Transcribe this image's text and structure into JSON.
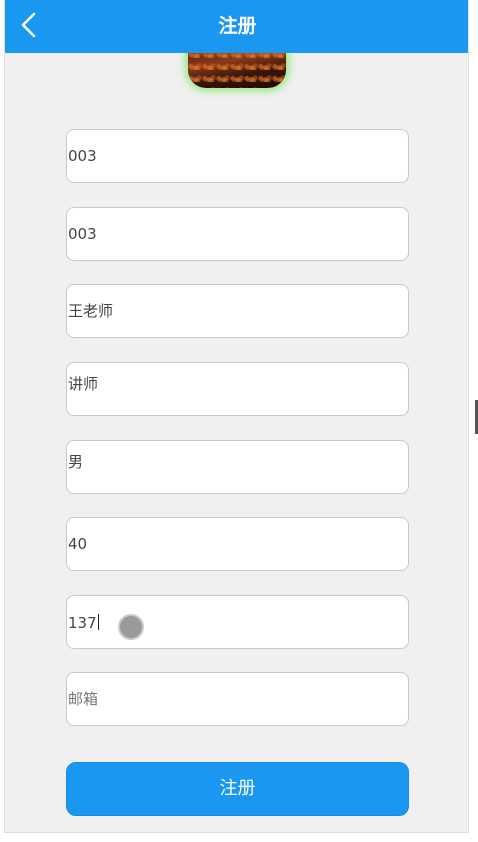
{
  "header": {
    "title": "注册",
    "back_icon": "chevron-left-icon",
    "background_color": "#1a97f1"
  },
  "form": {
    "fields": [
      {
        "name": "username-field",
        "value": "003",
        "placeholder": ""
      },
      {
        "name": "password-field",
        "value": "003",
        "placeholder": ""
      },
      {
        "name": "name-field",
        "value": "王老师",
        "placeholder": ""
      },
      {
        "name": "title-field",
        "value": "讲师",
        "placeholder": ""
      },
      {
        "name": "gender-field",
        "value": "男",
        "placeholder": ""
      },
      {
        "name": "age-field",
        "value": "40",
        "placeholder": ""
      },
      {
        "name": "phone-field",
        "value": "137",
        "placeholder": ""
      },
      {
        "name": "email-field",
        "value": "",
        "placeholder": "邮箱"
      }
    ]
  },
  "submit": {
    "label": "注册",
    "color": "#1a97f1"
  }
}
